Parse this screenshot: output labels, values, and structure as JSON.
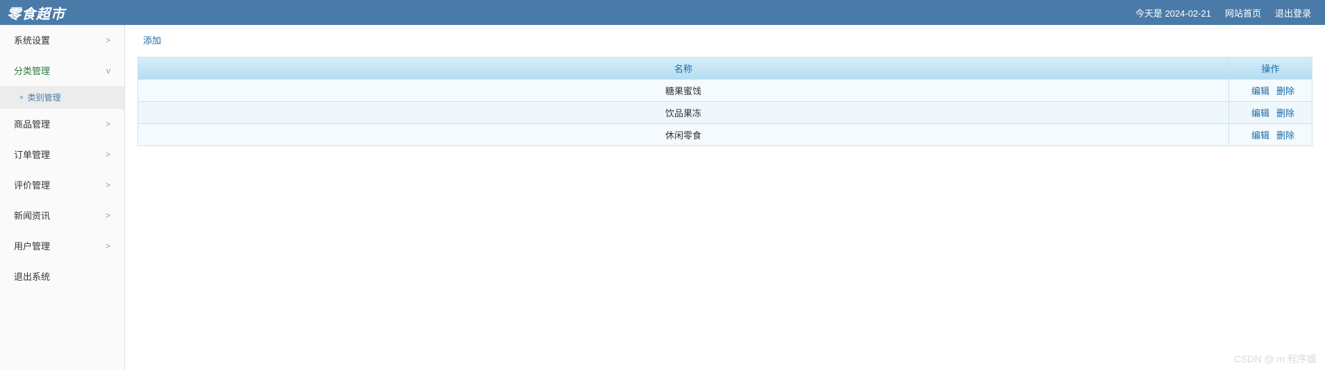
{
  "header": {
    "logo": "零食超市",
    "date_text": "今天是 2024-02-21",
    "home_link": "网站首页",
    "logout_link": "退出登录"
  },
  "sidebar": {
    "items": [
      {
        "label": "系统设置",
        "expanded": false
      },
      {
        "label": "分类管理",
        "expanded": true
      },
      {
        "label": "商品管理",
        "expanded": false
      },
      {
        "label": "订单管理",
        "expanded": false
      },
      {
        "label": "评价管理",
        "expanded": false
      },
      {
        "label": "新闻资讯",
        "expanded": false
      },
      {
        "label": "用户管理",
        "expanded": false
      },
      {
        "label": "退出系统",
        "expanded": null
      }
    ],
    "submenu_label": "类别管理"
  },
  "content": {
    "add_label": "添加",
    "table": {
      "headers": {
        "name": "名称",
        "action": "操作"
      },
      "rows": [
        {
          "name": "糖果蜜饯"
        },
        {
          "name": "饮品果冻"
        },
        {
          "name": "休闲零食"
        }
      ],
      "action_labels": {
        "edit": "编辑",
        "delete": "删除"
      }
    }
  },
  "watermark": "CSDN @ m 程序媛"
}
